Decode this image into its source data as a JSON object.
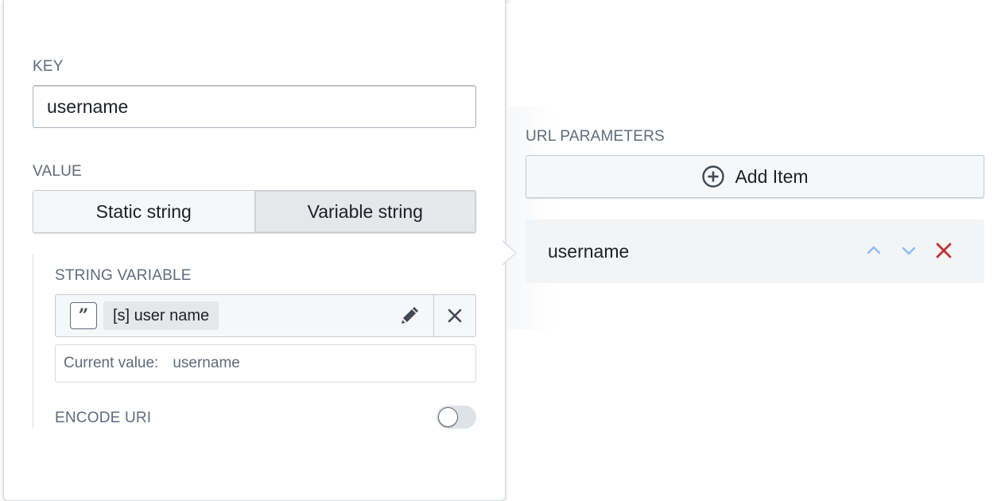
{
  "key_field": {
    "label": "KEY",
    "value": "username"
  },
  "value_field": {
    "label": "VALUE",
    "options": [
      "Static string",
      "Variable string"
    ],
    "selected": "Variable string"
  },
  "string_variable": {
    "label": "STRING VARIABLE",
    "tag": "[s] user name",
    "icon": "quote-icon",
    "current_value_label": "Current value:",
    "current_value": "username"
  },
  "encode_uri": {
    "label": "ENCODE URI",
    "enabled": false
  },
  "url_parameters": {
    "label": "URL PARAMETERS",
    "add_label": "Add Item",
    "items": [
      {
        "name": "username"
      }
    ]
  },
  "colors": {
    "delete": "#c23030",
    "arrow_icons": "#8abbff"
  }
}
